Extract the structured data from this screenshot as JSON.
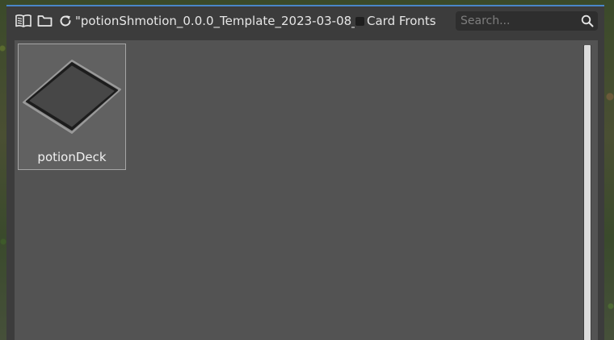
{
  "toolbar": {
    "icons": [
      "book-icon",
      "folder-icon",
      "refresh-icon"
    ],
    "path": "\"potionShmotion_0.0.0_Template_2023-03-08_",
    "tab_label": "Card Fronts",
    "tab_color": "#1e1e1e"
  },
  "search": {
    "placeholder": "Search...",
    "value": ""
  },
  "items": [
    {
      "label": "potionDeck",
      "icon": "card-deck-icon"
    }
  ],
  "colors": {
    "accent": "#4a86c8",
    "panel_bg": "#535353",
    "window_bg": "#3c3c3c"
  }
}
